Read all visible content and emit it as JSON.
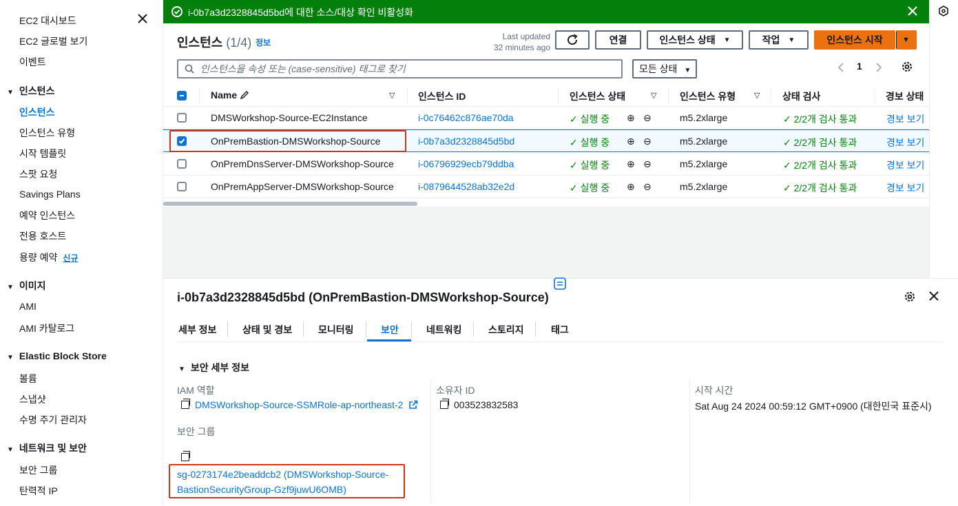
{
  "sidebar": {
    "top_items": [
      "EC2 대시보드",
      "EC2 글로벌 보기",
      "이벤트"
    ],
    "sections": [
      {
        "title": "인스턴스",
        "items": [
          "인스턴스",
          "인스턴스 유형",
          "시작 템플릿",
          "스팟 요청",
          "Savings Plans",
          "예약 인스턴스",
          "전용 호스트",
          "용량 예약"
        ]
      },
      {
        "title": "이미지",
        "items": [
          "AMI",
          "AMI 카탈로그"
        ]
      },
      {
        "title": "Elastic Block Store",
        "items": [
          "볼륨",
          "스냅샷",
          "수명 주기 관리자"
        ]
      },
      {
        "title": "네트워크 및 보안",
        "items": [
          "보안 그룹",
          "탄력적 IP"
        ]
      }
    ],
    "new_badge": "신규",
    "active_item": "인스턴스"
  },
  "flash": {
    "message": "i-0b7a3d2328845d5bd에 대한 소스/대상 확인 비활성화"
  },
  "header": {
    "title": "인스턴스",
    "count": "(1/4)",
    "info": "정보",
    "last_updated_line1": "Last updated",
    "last_updated_line2": "32 minutes ago",
    "connect_label": "연결",
    "instance_state_label": "인스턴스 상태",
    "actions_label": "작업",
    "launch_label": "인스턴스 시작"
  },
  "search": {
    "placeholder": "인스턴스을 속성 또는 (case-sensitive) 태그로 찾기",
    "state_filter": "모든 상태"
  },
  "pager": {
    "page": "1"
  },
  "table": {
    "columns": [
      "Name",
      "인스턴스 ID",
      "인스턴스 상태",
      "인스턴스 유형",
      "상태 검사",
      "경보 상태"
    ],
    "rows": [
      {
        "name": "DMSWorkshop-Source-EC2Instance",
        "id": "i-0c76462c876ae70da",
        "state": "실행 중",
        "type": "m5.2xlarge",
        "check": "2/2개 검사 통과",
        "alarm": "경보 보기",
        "selected": false
      },
      {
        "name": "OnPremBastion-DMSWorkshop-Source",
        "id": "i-0b7a3d2328845d5bd",
        "state": "실행 중",
        "type": "m5.2xlarge",
        "check": "2/2개 검사 통과",
        "alarm": "경보 보기",
        "selected": true
      },
      {
        "name": "OnPremDnsServer-DMSWorkshop-Source",
        "id": "i-06796929ecb79ddba",
        "state": "실행 중",
        "type": "m5.2xlarge",
        "check": "2/2개 검사 통과",
        "alarm": "경보 보기",
        "selected": false
      },
      {
        "name": "OnPremAppServer-DMSWorkshop-Source",
        "id": "i-0879644528ab32e2d",
        "state": "실행 중",
        "type": "m5.2xlarge",
        "check": "2/2개 검사 통과",
        "alarm": "경보 보기",
        "selected": false
      }
    ]
  },
  "detail": {
    "title": "i-0b7a3d2328845d5bd (OnPremBastion-DMSWorkshop-Source)",
    "tabs": [
      "세부 정보",
      "상태 및 경보",
      "모니터링",
      "보안",
      "네트워킹",
      "스토리지",
      "태그"
    ],
    "active_tab": "보안",
    "section_title": "보안 세부 정보",
    "iam_label": "IAM 역할",
    "iam_value": "DMSWorkshop-Source-SSMRole-ap-northeast-2",
    "owner_label": "소유자 ID",
    "owner_value": "003523832583",
    "launch_label": "시작 시간",
    "launch_value": "Sat Aug 24 2024 00:59:12 GMT+0900 (대한민국 표준시)",
    "sg_label": "보안 그룹",
    "sg_line1": "sg-0273174e2beaddcb2 (DMSWorkshop-Source-",
    "sg_line2": "BastionSecurityGroup-Gzf9juwU6OMB)"
  },
  "colors": {
    "link": "#0972d3",
    "success": "#037f0c",
    "primary": "#ec7211",
    "highlight": "#d13212"
  }
}
